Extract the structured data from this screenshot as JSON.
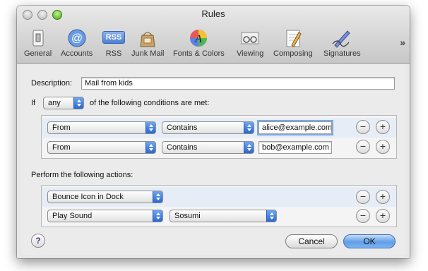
{
  "window": {
    "title": "Rules"
  },
  "toolbar": {
    "items": [
      {
        "label": "General",
        "icon": "general-switch-icon"
      },
      {
        "label": "Accounts",
        "icon": "at-sign-icon"
      },
      {
        "label": "RSS",
        "icon": "rss-icon"
      },
      {
        "label": "Junk Mail",
        "icon": "junk-mail-bag-icon"
      },
      {
        "label": "Fonts & Colors",
        "icon": "fonts-colors-icon"
      },
      {
        "label": "Viewing",
        "icon": "viewing-glasses-icon"
      },
      {
        "label": "Composing",
        "icon": "composing-pencil-icon"
      },
      {
        "label": "Signatures",
        "icon": "signature-pen-icon"
      }
    ],
    "overflow_label": "»",
    "rss_badge": "RSS"
  },
  "rule": {
    "description_label": "Description:",
    "description_value": "Mail from kids",
    "if_label": "If",
    "match_mode": "any",
    "conditions_suffix": "of the following conditions are met:",
    "conditions": [
      {
        "field": "From",
        "operator": "Contains",
        "value": "alice@example.com"
      },
      {
        "field": "From",
        "operator": "Contains",
        "value": "bob@example.com"
      }
    ],
    "actions_label": "Perform the following actions:",
    "actions": [
      {
        "action": "Bounce Icon in Dock"
      },
      {
        "action": "Play Sound",
        "sound": "Sosumi"
      }
    ]
  },
  "controls": {
    "minus": "−",
    "plus": "+",
    "help": "?"
  },
  "buttons": {
    "cancel": "Cancel",
    "ok": "OK"
  }
}
